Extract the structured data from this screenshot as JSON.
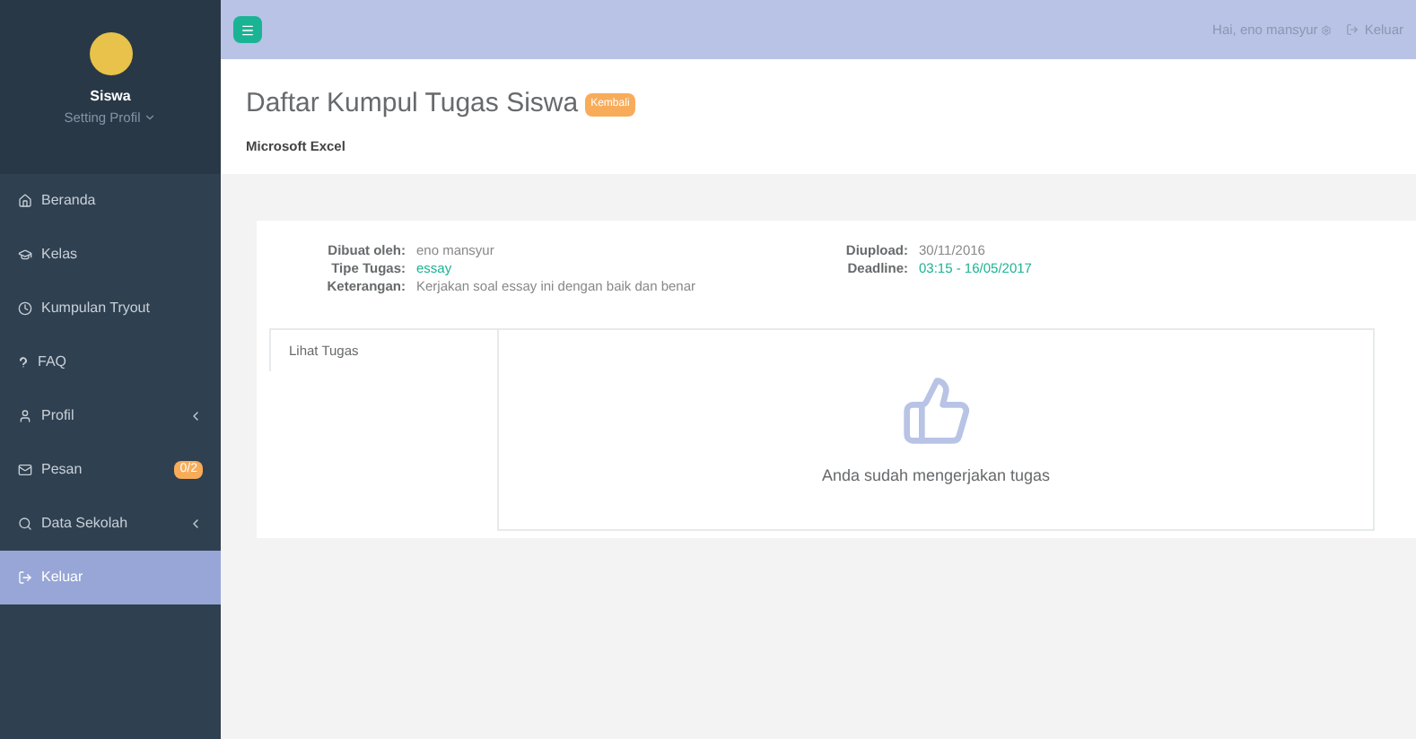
{
  "sidebar": {
    "profile": {
      "name": "Siswa",
      "menu": "Setting Profil"
    },
    "items": [
      {
        "label": "Beranda",
        "selected": false,
        "expandable": false
      },
      {
        "label": "Kelas",
        "selected": false,
        "expandable": false
      },
      {
        "label": "Kumpulan Tryout",
        "selected": false,
        "expandable": false
      },
      {
        "label": "FAQ",
        "selected": false,
        "expandable": false
      },
      {
        "label": "Profil",
        "selected": false,
        "expandable": true
      },
      {
        "label": "Pesan",
        "selected": false,
        "expandable": false,
        "badge": "0/2"
      },
      {
        "label": "Data Sekolah",
        "selected": false,
        "expandable": true
      },
      {
        "label": "Keluar",
        "selected": true,
        "expandable": false
      }
    ]
  },
  "topbar": {
    "greeting": "Hai, eno mansyur",
    "logout": "Keluar"
  },
  "header": {
    "title": "Daftar Kumpul Tugas Siswa",
    "back": "Kembali",
    "subtitle": "Microsoft Excel"
  },
  "details_left": [
    {
      "label": "Dibuat oleh:",
      "value": "eno mansyur",
      "highlight": false
    },
    {
      "label": "Tipe Tugas:",
      "value": "essay",
      "highlight": true
    },
    {
      "label": "Keterangan:",
      "value": "Kerjakan soal essay ini dengan baik dan benar",
      "highlight": false
    }
  ],
  "details_right": [
    {
      "label": "Diupload:",
      "value": "30/11/2016",
      "highlight": false
    },
    {
      "label": "Deadline:",
      "value": "03:15 - 16/05/2017",
      "highlight": true
    }
  ],
  "tabs": [
    {
      "label": "Lihat Tugas",
      "selected": true
    }
  ],
  "result": {
    "message": "Anda sudah mengerjakan tugas"
  }
}
